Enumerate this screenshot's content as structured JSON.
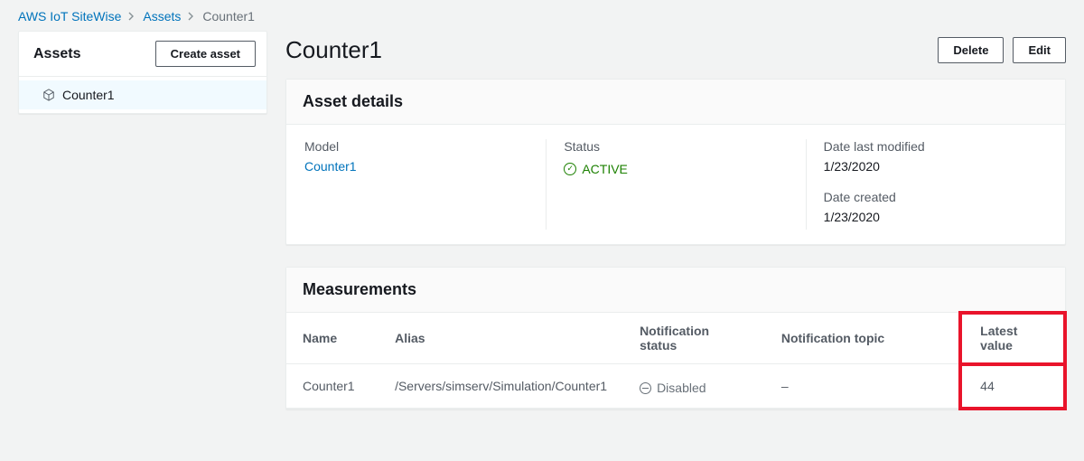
{
  "breadcrumb": {
    "service": "AWS IoT SiteWise",
    "section": "Assets",
    "current": "Counter1"
  },
  "sidebar": {
    "title": "Assets",
    "create_btn": "Create asset",
    "items": [
      {
        "label": "Counter1"
      }
    ]
  },
  "header": {
    "title": "Counter1",
    "delete_btn": "Delete",
    "edit_btn": "Edit"
  },
  "details": {
    "panel_title": "Asset details",
    "model_label": "Model",
    "model_value": "Counter1",
    "status_label": "Status",
    "status_value": "ACTIVE",
    "modified_label": "Date last modified",
    "modified_value": "1/23/2020",
    "created_label": "Date created",
    "created_value": "1/23/2020"
  },
  "measurements": {
    "panel_title": "Measurements",
    "columns": {
      "name": "Name",
      "alias": "Alias",
      "notif_status": "Notification status",
      "notif_topic": "Notification topic",
      "latest": "Latest value"
    },
    "rows": [
      {
        "name": "Counter1",
        "alias": "/Servers/simserv/Simulation/Counter1",
        "notif_status": "Disabled",
        "notif_topic": "–",
        "latest": "44"
      }
    ]
  }
}
